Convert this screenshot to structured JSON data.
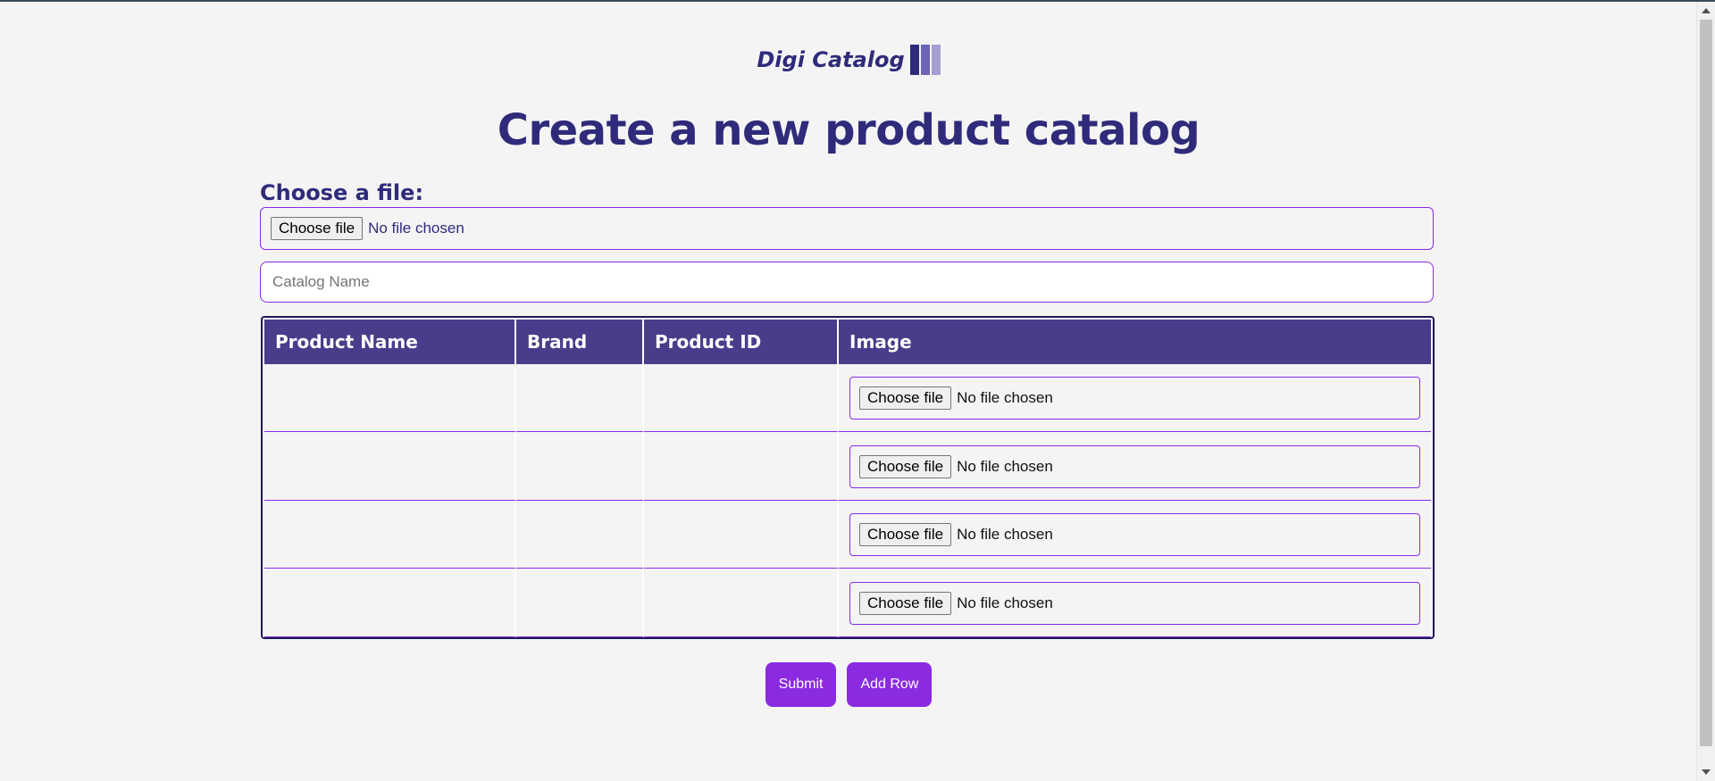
{
  "brand": {
    "name": "Digi Catalog",
    "logo_icon": "bars-logo-icon"
  },
  "page_title": "Create a new product catalog",
  "file_upload": {
    "label": "Choose a file:",
    "button": "Choose file",
    "status": "No file chosen"
  },
  "catalog_name": {
    "placeholder": "Catalog Name",
    "value": ""
  },
  "table": {
    "headers": [
      "Product Name",
      "Brand",
      "Product ID",
      "Image"
    ],
    "rows": [
      {
        "product_name": "",
        "brand": "",
        "product_id": "",
        "image_button": "Choose file",
        "image_status": "No file chosen"
      },
      {
        "product_name": "",
        "brand": "",
        "product_id": "",
        "image_button": "Choose file",
        "image_status": "No file chosen"
      },
      {
        "product_name": "",
        "brand": "",
        "product_id": "",
        "image_button": "Choose file",
        "image_status": "No file chosen"
      },
      {
        "product_name": "",
        "brand": "",
        "product_id": "",
        "image_button": "Choose file",
        "image_status": "No file chosen"
      }
    ]
  },
  "actions": {
    "submit": "Submit",
    "add_row": "Add Row"
  },
  "colors": {
    "primary": "#2f2b7a",
    "accent": "#8a2be2",
    "header_bg": "#4a3c8a"
  }
}
